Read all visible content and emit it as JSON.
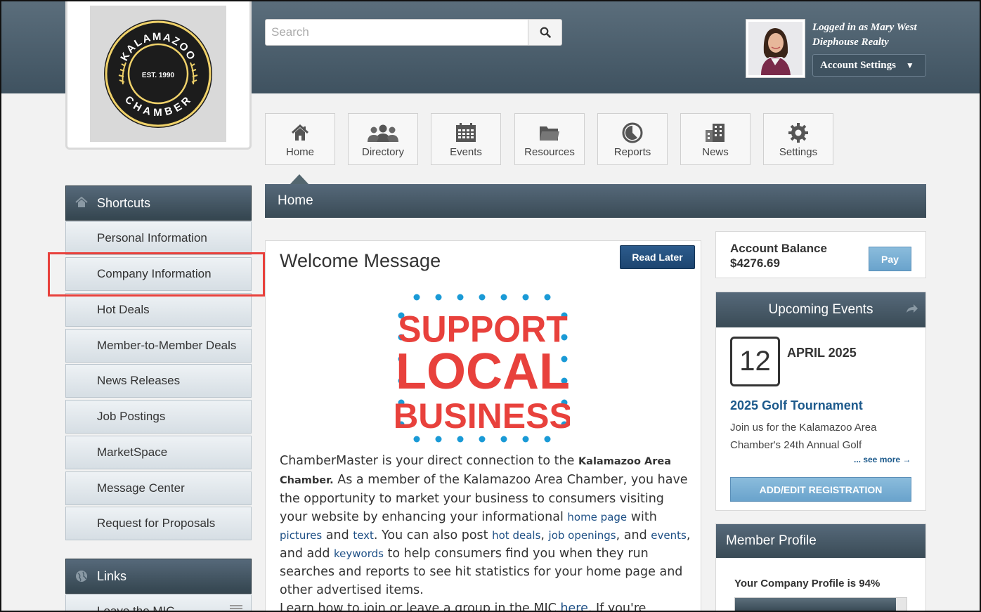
{
  "logo": {
    "name_top": "KALAMAZOO",
    "established": "EST. 1990",
    "name_bottom": "CHAMBER"
  },
  "search": {
    "placeholder": "Search"
  },
  "user": {
    "logged_in_as": "Logged in as Mary West",
    "company": "Diephouse Realty",
    "account_settings": "Account Settings"
  },
  "nav": [
    {
      "label": "Home",
      "icon": "home-icon"
    },
    {
      "label": "Directory",
      "icon": "people-icon"
    },
    {
      "label": "Events",
      "icon": "calendar-icon"
    },
    {
      "label": "Resources",
      "icon": "folder-icon"
    },
    {
      "label": "Reports",
      "icon": "pie-chart-icon"
    },
    {
      "label": "News",
      "icon": "building-icon"
    },
    {
      "label": "Settings",
      "icon": "gear-icon"
    }
  ],
  "sidebar": {
    "shortcuts_title": "Shortcuts",
    "items": [
      "Personal Information",
      "Company Information",
      "Hot Deals",
      "Member-to-Member Deals",
      "News Releases",
      "Job Postings",
      "MarketSpace",
      "Message Center",
      "Request for Proposals"
    ],
    "links_title": "Links",
    "links_first_item": "Leave the MIC"
  },
  "main": {
    "breadcrumb": "Home",
    "welcome": {
      "title": "Welcome Message",
      "read_later": "Read Later",
      "promo": [
        "SUPPORT",
        "LOCAL",
        "BUSINESS"
      ],
      "p1": "ChamberMaster is your direct connection to the",
      "org": "Kalamazoo Area Chamber.",
      "p2": "As a member of the Kalamazoo Area Chamber, you have the opportunity to market your business to consumers visiting your website by enhancing your informational",
      "link_home_page": "home page",
      "t_with": "with",
      "link_pictures": "pictures",
      "t_and": "and",
      "link_text": "text",
      "t_post": ". You can also post",
      "link_hot_deals": "hot deals",
      "t_comma": ",",
      "link_job_openings": "job openings",
      "t_and2": ", and",
      "link_events": "events",
      "t_add": ", and add",
      "link_keywords": "keywords",
      "p3": "to help consumers find you when they run searches and reports to see hit statistics for your home page and other advertised items.",
      "p4_start": "Learn how to join or leave a group in the MIC",
      "link_here": "here",
      "p4_end": ". If you're"
    }
  },
  "account": {
    "label": "Account Balance",
    "amount": "$4276.69",
    "pay": "Pay"
  },
  "events": {
    "title": "Upcoming Events",
    "day": "12",
    "month_year": "APRIL 2025",
    "event_title": "2025 Golf Tournament",
    "description": "Join us for the Kalamazoo Area Chamber's 24th Annual Golf",
    "see_more": "... see more →",
    "register": "ADD/EDIT REGISTRATION"
  },
  "profile": {
    "title": "Member Profile",
    "completion_text": "Your Company Profile is 94%",
    "completion_fraction": 0.94
  },
  "colors": {
    "header": "#4a5d6b",
    "accent_blue": "#1d5a8c",
    "highlight": "#e8413c",
    "promo_red": "#e8413c",
    "promo_dots": "#1a9ad6"
  }
}
